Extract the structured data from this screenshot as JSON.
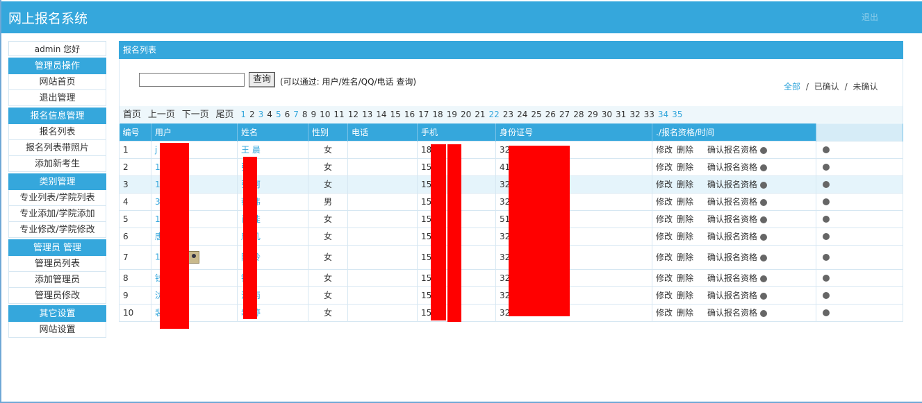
{
  "header": {
    "title": "网上报名系统",
    "logout": "退出"
  },
  "sidebar": {
    "welcome": "admin 您好",
    "sections": [
      {
        "head": "管理员操作",
        "items": [
          "网站首页",
          "退出管理"
        ]
      },
      {
        "head": "报名信息管理",
        "items": [
          "报名列表",
          "报名列表带照片",
          "添加新考生"
        ]
      },
      {
        "head": "类别管理",
        "items": [
          "专业列表/学院列表",
          "专业添加/学院添加",
          "专业修改/学院修改"
        ]
      },
      {
        "head": "管理员 管理",
        "items": [
          "管理员列表",
          "添加管理员",
          "管理员修改"
        ]
      },
      {
        "head": "其它设置",
        "items": [
          "网站设置"
        ]
      }
    ]
  },
  "main": {
    "title": "报名列表",
    "search": {
      "button": "查询",
      "hint": "(可以通过: 用户/姓名/QQ/电话 查询)",
      "value": ""
    },
    "filters": {
      "all": "全部",
      "sep": "/",
      "confirmed": "已确认",
      "unconfirmed": "未确认"
    },
    "pager": {
      "first": "首页",
      "prev": "上一页",
      "next": "下一页",
      "last": "尾页",
      "pages": [
        "1",
        "2",
        "3",
        "4",
        "5",
        "6",
        "7",
        "8",
        "9",
        "10",
        "11",
        "12",
        "13",
        "14",
        "15",
        "16",
        "17",
        "18",
        "19",
        "20",
        "21",
        "22",
        "23",
        "24",
        "25",
        "26",
        "27",
        "28",
        "29",
        "30",
        "31",
        "32",
        "33",
        "34",
        "35"
      ],
      "highlighted": [
        "1",
        "3",
        "5",
        "7",
        "22",
        "34",
        "35"
      ]
    },
    "columns": [
      "编号",
      "用户",
      "姓名",
      "性别",
      "电话",
      "手机",
      "身份证号",
      "./报名资格/时间",
      ""
    ],
    "row_actions": {
      "edit": "修改",
      "delete": "删除",
      "confirm": "确认报名资格"
    },
    "rows": [
      {
        "id": "1",
        "user": "j          2",
        "name": "王  晨",
        "gender": "女",
        "phone": "",
        "mobile": "18         61",
        "idcard": "32              04"
      },
      {
        "id": "2",
        "user": "1",
        "name": "张",
        "gender": "女",
        "phone": "",
        "mobile": "15          56",
        "idcard": "41              8"
      },
      {
        "id": "3",
        "user": "1       ly",
        "name": "张  珂",
        "gender": "女",
        "phone": "",
        "mobile": "15         02",
        "idcard": "32              3"
      },
      {
        "id": "4",
        "user": "3         9",
        "name": "蔡  伟",
        "gender": "男",
        "phone": "",
        "mobile": "15         01",
        "idcard": "32              8"
      },
      {
        "id": "5",
        "user": "1",
        "name": "肖  佳",
        "gender": "女",
        "phone": "",
        "mobile": "15         60",
        "idcard": "51              8"
      },
      {
        "id": "6",
        "user": "唐",
        "name": "唐  凡",
        "gender": "女",
        "phone": "",
        "mobile": "15         86",
        "idcard": "32"
      },
      {
        "id": "7",
        "user": "1",
        "name": "陈  玲",
        "gender": "女",
        "phone": "",
        "mobile": "15         21",
        "idcard": "32              9"
      },
      {
        "id": "8",
        "user": "钱",
        "name": "钱",
        "gender": "女",
        "phone": "",
        "mobile": "15         32",
        "idcard": "32              6"
      },
      {
        "id": "9",
        "user": "沈",
        "name": "沈  丙",
        "gender": "女",
        "phone": "",
        "mobile": "15         56",
        "idcard": "32              0"
      },
      {
        "id": "10",
        "user": "裴",
        "name": "裴  婷",
        "gender": "女",
        "phone": "",
        "mobile": "15         63",
        "idcard": "32              6"
      }
    ]
  }
}
